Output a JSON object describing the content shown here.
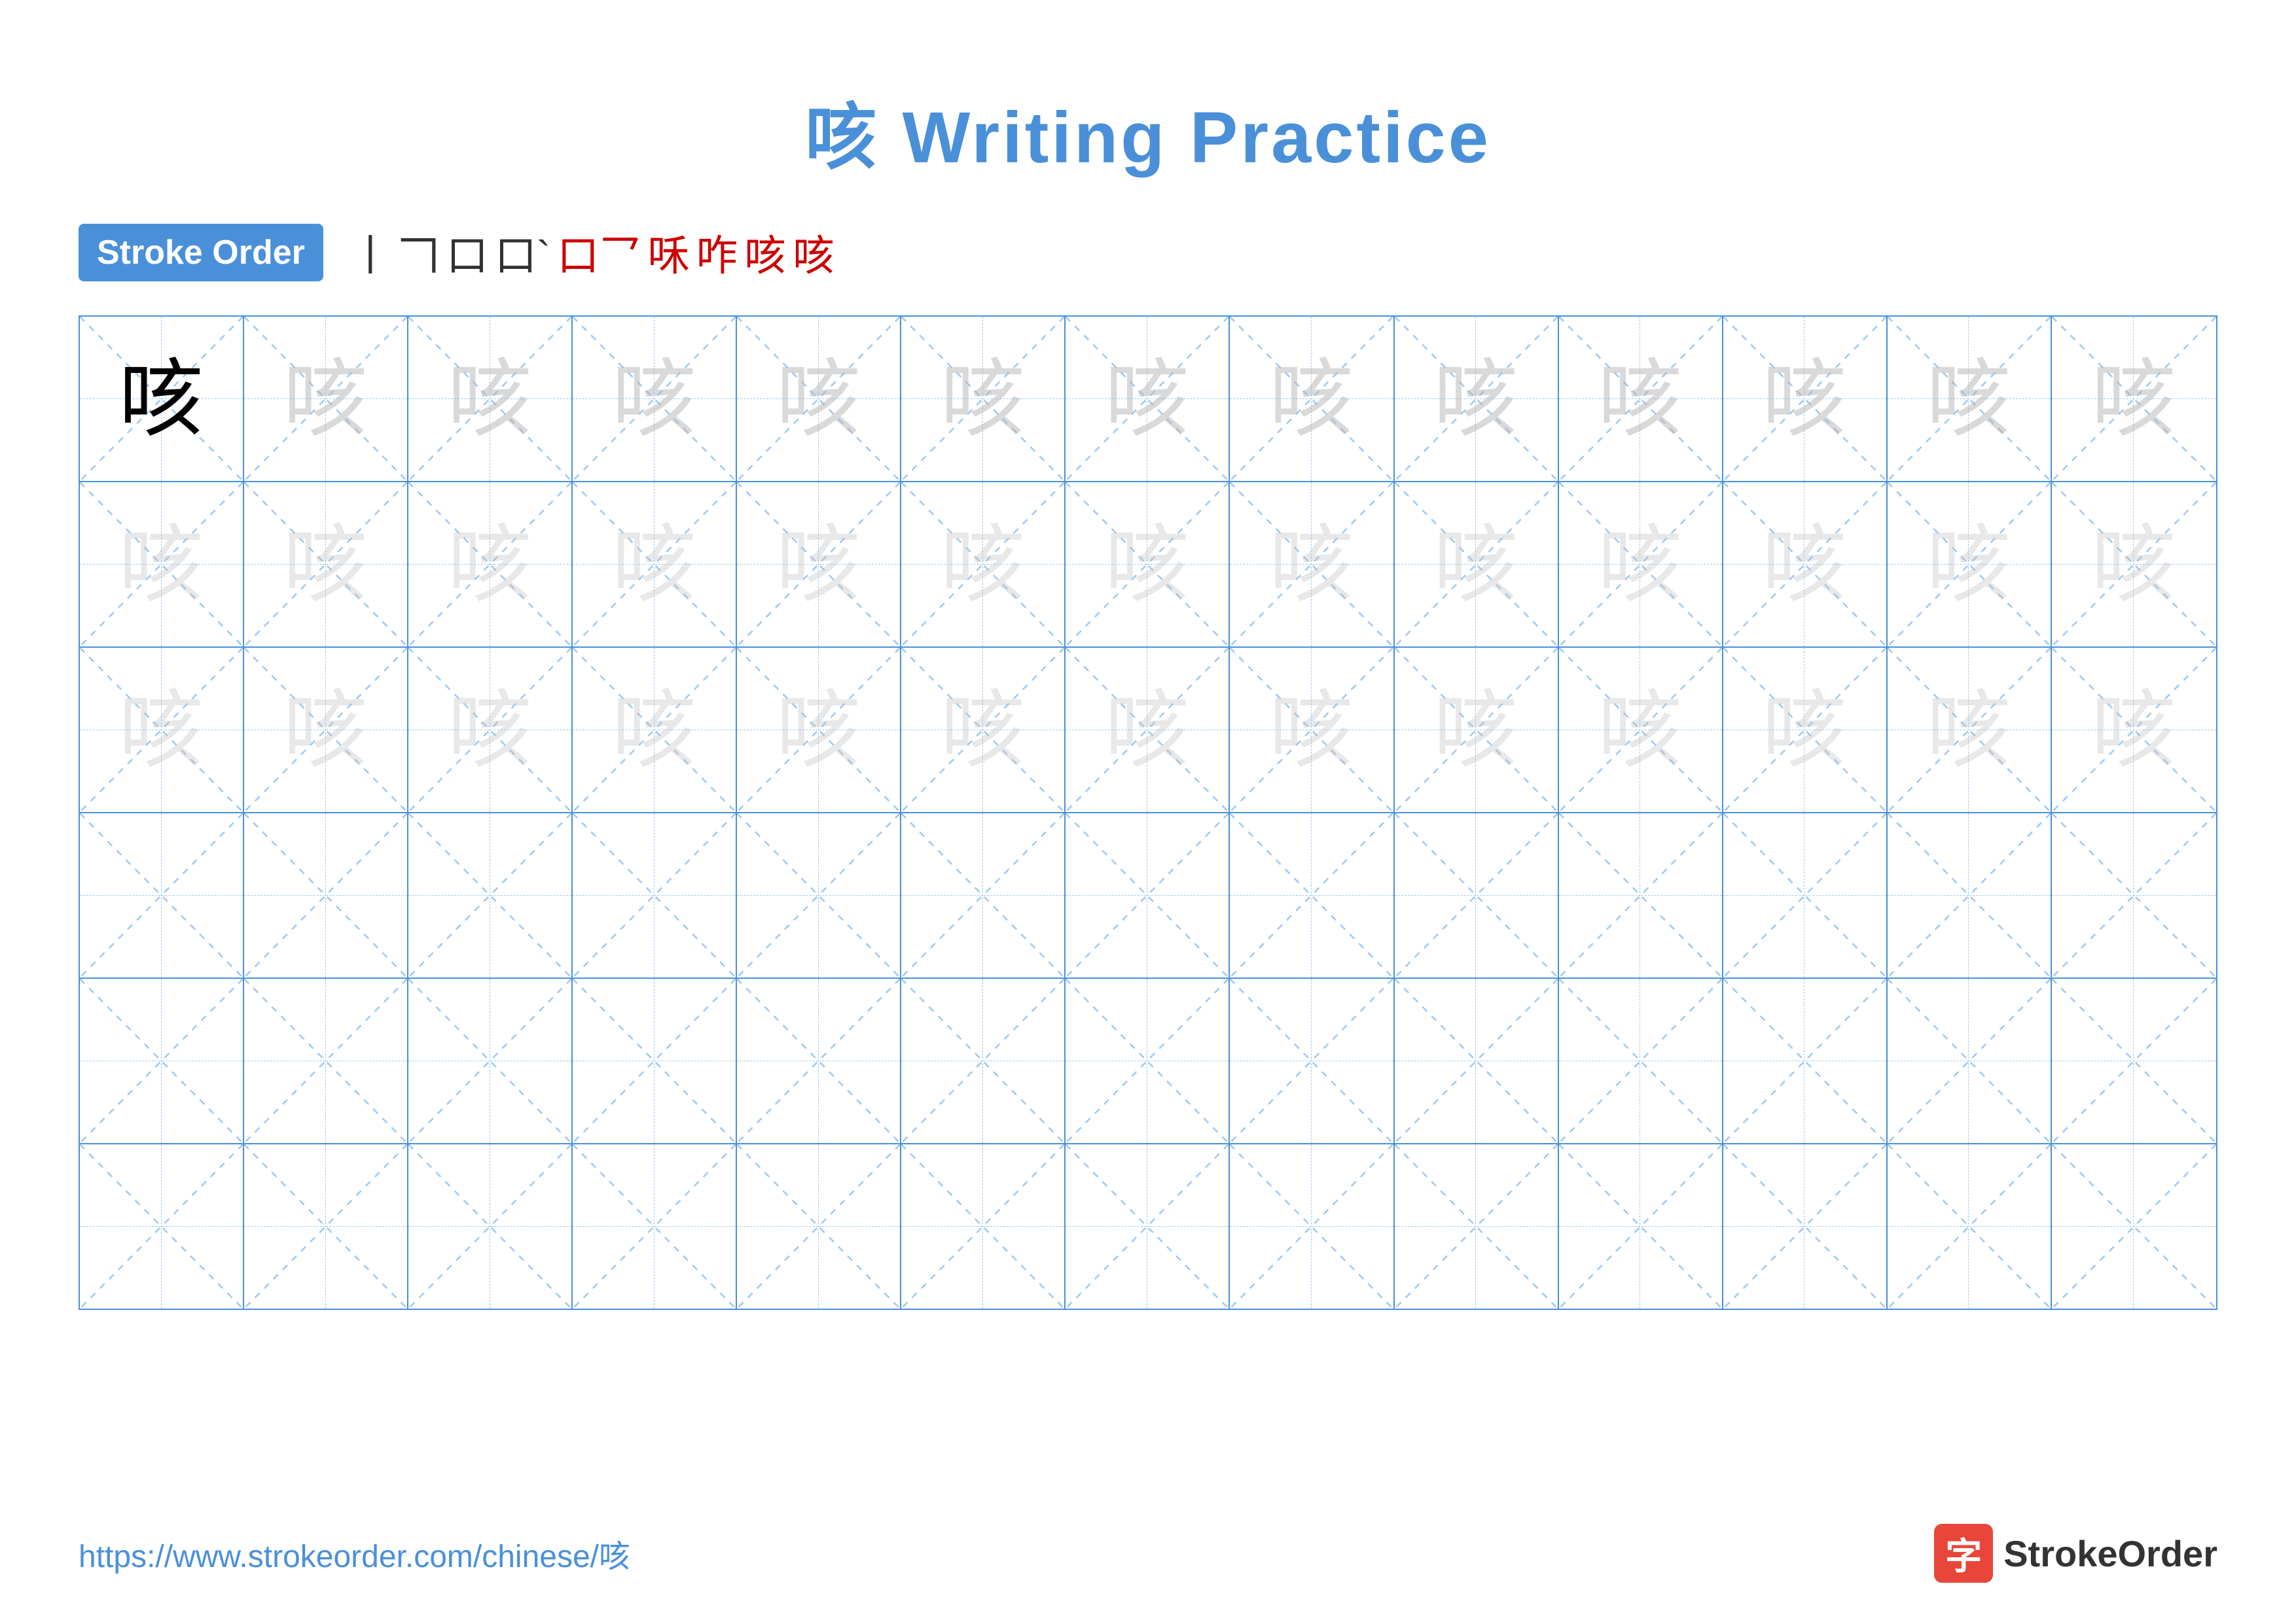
{
  "title": {
    "text": "咳 Writing Practice",
    "char": "咳"
  },
  "stroke_order": {
    "badge_label": "Stroke Order",
    "sequence": [
      "丨",
      "𠃍",
      "口",
      "口`",
      "口乛",
      "咊",
      "咋",
      "咳",
      "咳"
    ]
  },
  "grid": {
    "rows": 6,
    "cols": 13,
    "char": "咳",
    "row_types": [
      "solid_then_light",
      "lighter",
      "lighter",
      "empty",
      "empty",
      "empty"
    ]
  },
  "footer": {
    "url": "https://www.strokeorder.com/chinese/咳",
    "logo_char": "字",
    "logo_name": "StrokeOrder"
  }
}
